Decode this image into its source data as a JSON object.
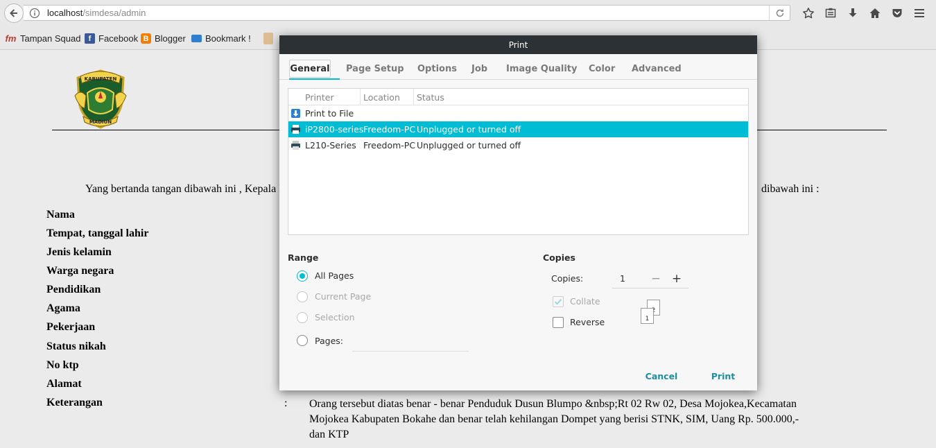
{
  "browser": {
    "url_host": "localhost",
    "url_path": "/simdesa/admin",
    "bookmarks": [
      {
        "label": "Tampan Squad",
        "icon": "fm-icon",
        "color": "#c0392b"
      },
      {
        "label": "Facebook",
        "icon": "facebook-icon",
        "color": "#3b5998"
      },
      {
        "label": "Blogger",
        "icon": "blogger-icon",
        "color": "#f57d00"
      },
      {
        "label": "Bookmark !",
        "icon": "folder-icon",
        "color": "#2f7fd1"
      }
    ],
    "toolbar_icons": [
      "star-icon",
      "reading-list-icon",
      "download-icon",
      "home-icon",
      "pocket-icon",
      "menu-icon"
    ]
  },
  "document": {
    "intro_start": "Yang bertanda tangan dibawah ini , Kepala I",
    "intro_end": "dibawah ini :",
    "fields": [
      "Nama",
      "Tempat, tanggal lahir",
      "Jenis kelamin",
      "Warga negara",
      "Pendidikan",
      "Agama",
      "Pekerjaan",
      "Status nikah",
      "No ktp",
      "Alamat",
      "Keterangan"
    ],
    "keterangan_colon": ":",
    "keterangan_value": "Orang tersebut diatas benar - benar Penduduk Dusun Blumpo &nbsp;Rt 02 Rw 02, Desa Mojokea,Kecamatan Mojokea Kabupaten Bokahe dan benar telah kehilangan Dompet yang berisi STNK, SIM, Uang Rp. 500.000,- dan KTP"
  },
  "dialog": {
    "title": "Print",
    "tabs": [
      "General",
      "Page Setup",
      "Options",
      "Job",
      "Image Quality",
      "Color",
      "Advanced"
    ],
    "active_tab": "General",
    "printer_columns": [
      "Printer",
      "Location",
      "Status"
    ],
    "printers": [
      {
        "name": "Print to File",
        "location": "",
        "status": "",
        "icon": "file-download-icon"
      },
      {
        "name": "iP2800-series",
        "location": "Freedom-PC",
        "status": "Unplugged or turned off",
        "icon": "printer-icon"
      },
      {
        "name": "L210-Series",
        "location": "Freedom-PC",
        "status": "Unplugged or turned off",
        "icon": "printer-icon"
      }
    ],
    "selected_printer": "iP2800-series",
    "range": {
      "title": "Range",
      "all_pages": "All Pages",
      "current_page": "Current Page",
      "selection": "Selection",
      "pages": "Pages:",
      "pages_value": ""
    },
    "copies": {
      "title": "Copies",
      "label": "Copies:",
      "value": "1",
      "minus": "−",
      "plus": "+",
      "collate": "Collate",
      "reverse": "Reverse",
      "preview_page_1": "1",
      "preview_page_2": "2"
    },
    "cancel_label": "Cancel",
    "print_label": "Print",
    "accent_color": "#00bcd4"
  }
}
